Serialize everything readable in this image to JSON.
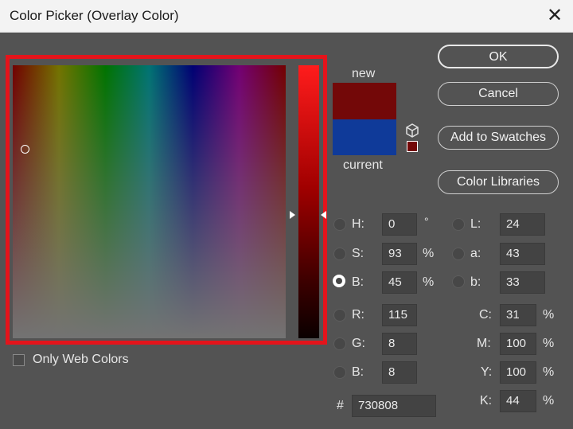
{
  "window": {
    "title": "Color Picker (Overlay Color)",
    "close_glyph": "✕"
  },
  "colors": {
    "new_hex": "#730808",
    "current_hex": "#0f3a99",
    "highlight": "#e4141b"
  },
  "preview": {
    "new_label": "new",
    "current_label": "current"
  },
  "buttons": {
    "ok": "OK",
    "cancel": "Cancel",
    "add_to_swatches": "Add to Swatches",
    "color_libraries": "Color Libraries"
  },
  "hsb": {
    "h": {
      "label": "H:",
      "value": "0",
      "unit": "°"
    },
    "s": {
      "label": "S:",
      "value": "93",
      "unit": "%"
    },
    "b": {
      "label": "B:",
      "value": "45",
      "unit": "%",
      "selected": true
    }
  },
  "rgb": {
    "r": {
      "label": "R:",
      "value": "115"
    },
    "g": {
      "label": "G:",
      "value": "8"
    },
    "b": {
      "label": "B:",
      "value": "8"
    }
  },
  "lab": {
    "l": {
      "label": "L:",
      "value": "24"
    },
    "a": {
      "label": "a:",
      "value": "43"
    },
    "b": {
      "label": "b:",
      "value": "33"
    }
  },
  "cmyk": {
    "c": {
      "label": "C:",
      "value": "31",
      "unit": "%"
    },
    "m": {
      "label": "M:",
      "value": "100",
      "unit": "%"
    },
    "y": {
      "label": "Y:",
      "value": "100",
      "unit": "%"
    },
    "k": {
      "label": "K:",
      "value": "44",
      "unit": "%"
    }
  },
  "hex": {
    "label": "#",
    "value": "730808"
  },
  "options": {
    "only_web_colors": "Only Web Colors"
  },
  "icons": {
    "out_of_gamut": "cube-icon",
    "gamut_swatch": "gamut-swatch-icon",
    "close": "close-icon"
  }
}
